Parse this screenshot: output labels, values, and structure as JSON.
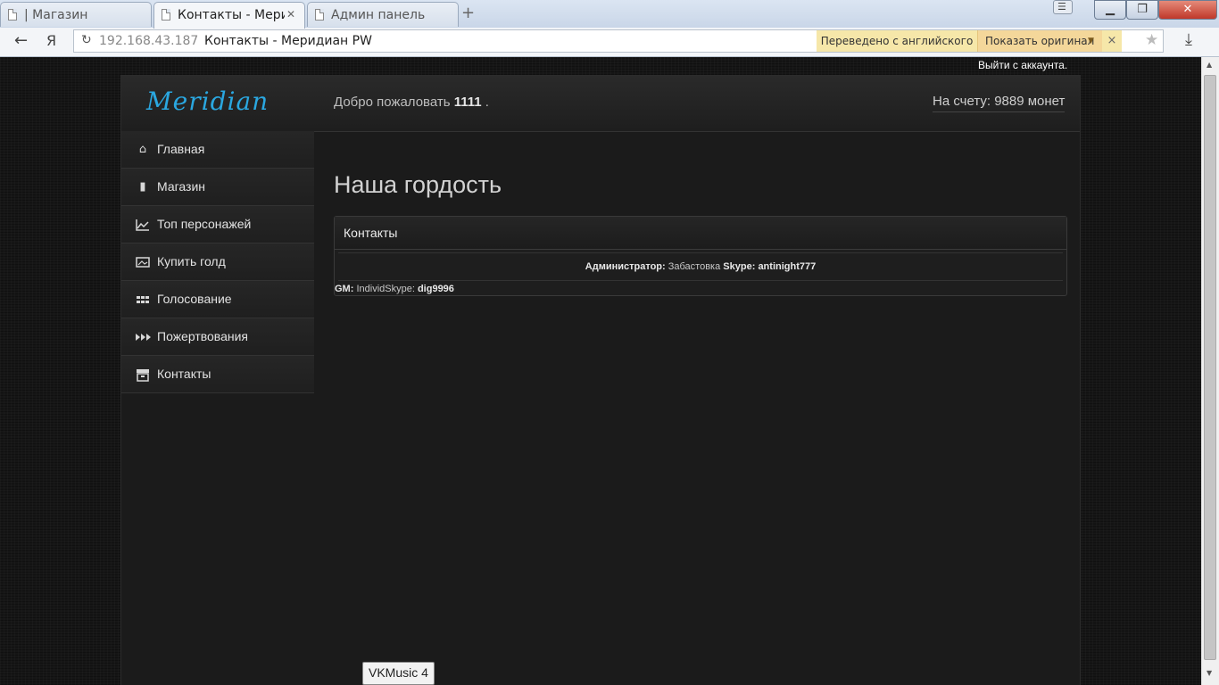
{
  "browser": {
    "tabs": [
      {
        "title": "| Магазин",
        "active": false
      },
      {
        "title": "Контакты - Мериди",
        "active": true
      },
      {
        "title": "Админ панель",
        "active": false
      }
    ],
    "new_tab_label": "+",
    "address": {
      "host": "192.168.43.187",
      "title": "Контакты - Меридиан PW"
    },
    "translate": {
      "note": "Переведено с английского",
      "show_original": "Показать оригинал",
      "close": "×"
    },
    "window_buttons": {
      "minimize": "▁",
      "maximize": "❐",
      "close": "✕"
    }
  },
  "page": {
    "logout_label": "Выйти с аккаунта.",
    "logo": "Meridian",
    "welcome": {
      "prefix": "Добро пожаловать",
      "user": "1111",
      "suffix": "."
    },
    "balance": "На счету: 9889 монет",
    "sidebar": {
      "items": [
        {
          "label": "Главная",
          "icon": "home-icon"
        },
        {
          "label": "Магазин",
          "icon": "book-icon"
        },
        {
          "label": "Топ персонажей",
          "icon": "chart-icon"
        },
        {
          "label": "Купить голд",
          "icon": "picture-icon"
        },
        {
          "label": "Голосование",
          "icon": "grid-icon"
        },
        {
          "label": "Пожертвования",
          "icon": "forward-icon"
        },
        {
          "label": "Контакты",
          "icon": "archive-icon"
        }
      ]
    },
    "heading": "Наша гордость",
    "contacts_panel": {
      "title": "Контакты",
      "admin": {
        "role": "Администратор:",
        "name": "Забастовка",
        "skype_label": "Skype:",
        "skype": "antinight777"
      },
      "gm": {
        "role": "GM:",
        "name": "Individ",
        "skype_label": "Skype:",
        "skype": "dig9996"
      }
    }
  },
  "tooltip": "VKMusic 4",
  "colors": {
    "logo": "#2aa7e0",
    "background": "#161616",
    "translate_bar": "#f6e7a9"
  }
}
